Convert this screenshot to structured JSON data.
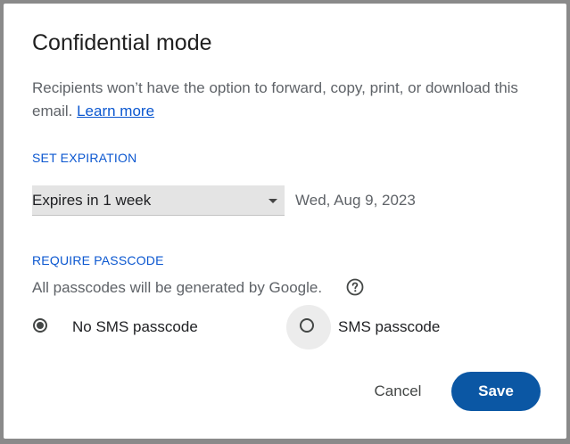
{
  "dialog": {
    "title": "Confidential mode",
    "description": "Recipients won’t have the option to forward, copy, print, or download this email.",
    "learn_more": "Learn more"
  },
  "expiration": {
    "section_label": "SET EXPIRATION",
    "selected": "Expires in 1 week",
    "date": "Wed, Aug 9, 2023"
  },
  "passcode": {
    "section_label": "REQUIRE PASSCODE",
    "note": "All passcodes will be generated by Google.",
    "options": [
      {
        "label": "No SMS passcode",
        "selected": true
      },
      {
        "label": "SMS passcode",
        "selected": false
      }
    ]
  },
  "actions": {
    "cancel": "Cancel",
    "save": "Save"
  },
  "colors": {
    "accent": "#0b57d0",
    "save_button": "#0b57a4"
  },
  "icons": {
    "dropdown": "triangle-down",
    "help": "question-circle"
  }
}
